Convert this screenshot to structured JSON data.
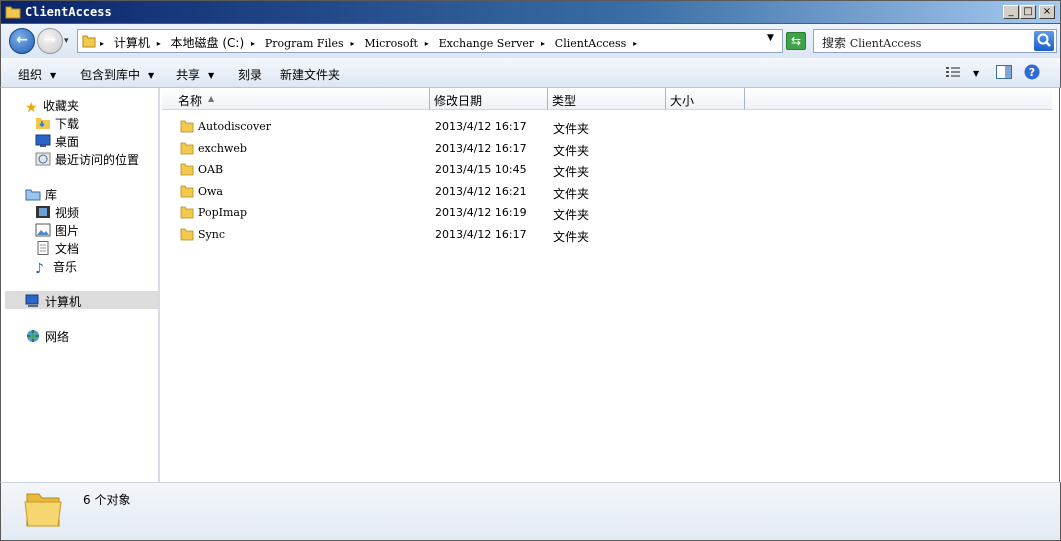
{
  "window": {
    "title": "ClientAccess",
    "min_label": "_",
    "max_label": "□",
    "close_label": "×"
  },
  "address": {
    "crumbs": [
      "计算机",
      "本地磁盘 (C:)",
      "Program Files",
      "Microsoft",
      "Exchange Server",
      "ClientAccess"
    ]
  },
  "search": {
    "placeholder_prefix": "搜索",
    "placeholder_target": "ClientAccess"
  },
  "toolbar": {
    "organize": "组织",
    "include_library": "包含到库中",
    "share": "共享",
    "burn": "刻录",
    "new_folder": "新建文件夹"
  },
  "nav": {
    "favorites": "收藏夹",
    "downloads": "下载",
    "desktop": "桌面",
    "recent": "最近访问的位置",
    "libraries": "库",
    "videos": "视频",
    "pictures": "图片",
    "documents": "文档",
    "music": "音乐",
    "computer": "计算机",
    "network": "网络"
  },
  "columns": {
    "name": "名称",
    "modified": "修改日期",
    "type": "类型",
    "size": "大小"
  },
  "files": [
    {
      "name": "Autodiscover",
      "date": "2013/4/12 16:17",
      "type": "文件夹"
    },
    {
      "name": "exchweb",
      "date": "2013/4/12 16:17",
      "type": "文件夹"
    },
    {
      "name": "OAB",
      "date": "2013/4/15 10:45",
      "type": "文件夹"
    },
    {
      "name": "Owa",
      "date": "2013/4/12 16:21",
      "type": "文件夹"
    },
    {
      "name": "PopImap",
      "date": "2013/4/12 16:19",
      "type": "文件夹"
    },
    {
      "name": "Sync",
      "date": "2013/4/12 16:17",
      "type": "文件夹"
    }
  ],
  "status": {
    "count": "6 个对象"
  },
  "colors": {
    "folder": "#f2c94c",
    "title_bar": "#0a246a"
  }
}
